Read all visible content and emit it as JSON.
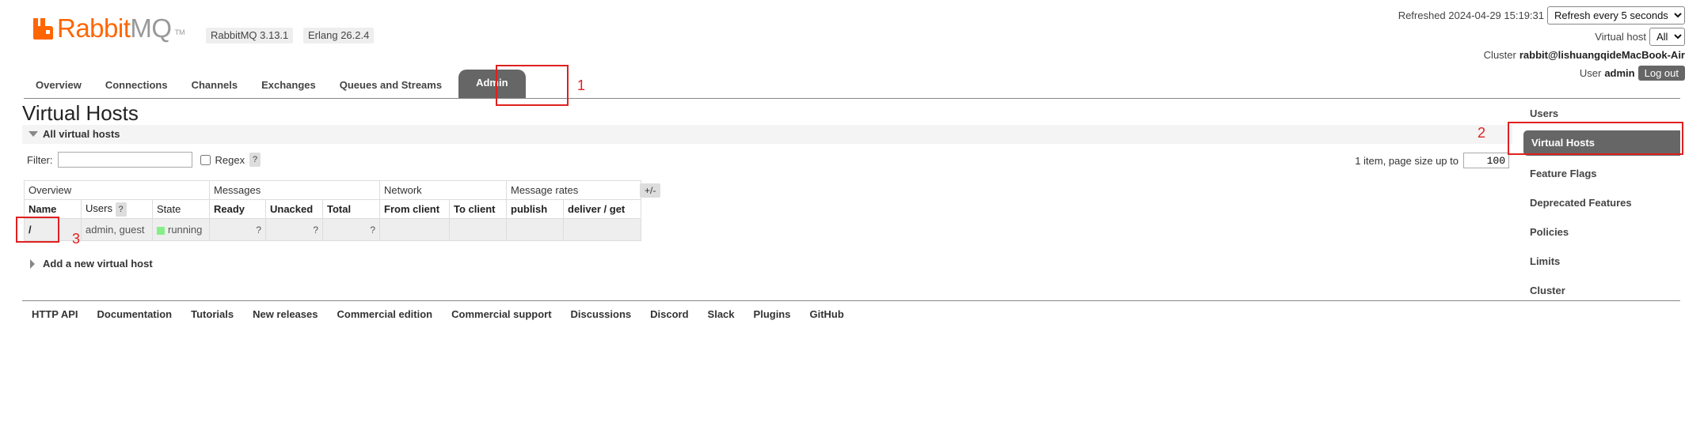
{
  "logo": {
    "part_a": "Rabbit",
    "part_b": "MQ",
    "tm": "TM"
  },
  "versions": {
    "rabbitmq": "RabbitMQ 3.13.1",
    "erlang": "Erlang 26.2.4"
  },
  "header": {
    "refreshed_label": "Refreshed 2024-04-29 15:19:31",
    "refresh_select": "Refresh every 5 seconds",
    "vhost_label": "Virtual host",
    "vhost_select": "All",
    "cluster_label": "Cluster",
    "cluster_value": "rabbit@lishuangqideMacBook-Air",
    "user_label": "User",
    "user_value": "admin",
    "logout": "Log out"
  },
  "tabs": [
    "Overview",
    "Connections",
    "Channels",
    "Exchanges",
    "Queues and Streams",
    "Admin"
  ],
  "active_tab": "Admin",
  "page_title": "Virtual Hosts",
  "section": {
    "label": "All virtual hosts"
  },
  "filter": {
    "label": "Filter:",
    "value": "",
    "regex_label": "Regex",
    "help": "?"
  },
  "pagination": {
    "label": "1 item, page size up to",
    "page_size": "100"
  },
  "table": {
    "groups": [
      "Overview",
      "Messages",
      "Network",
      "Message rates"
    ],
    "columns": [
      "Name",
      "Users",
      "State",
      "Ready",
      "Unacked",
      "Total",
      "From client",
      "To client",
      "publish",
      "deliver / get"
    ],
    "users_help": "?",
    "plusminus": "+/-",
    "rows": [
      {
        "name": "/",
        "users": "admin, guest",
        "state": "running",
        "ready": "?",
        "unacked": "?",
        "total": "?",
        "from_client": "",
        "to_client": "",
        "publish": "",
        "deliver_get": ""
      }
    ]
  },
  "add_new": "Add a new virtual host",
  "footer": [
    "HTTP API",
    "Documentation",
    "Tutorials",
    "New releases",
    "Commercial edition",
    "Commercial support",
    "Discussions",
    "Discord",
    "Slack",
    "Plugins",
    "GitHub"
  ],
  "sidebar": [
    "Users",
    "Virtual Hosts",
    "Feature Flags",
    "Deprecated Features",
    "Policies",
    "Limits",
    "Cluster"
  ],
  "active_sidebar": "Virtual Hosts",
  "annotations": [
    "1",
    "2",
    "3"
  ],
  "colors": {
    "brand_orange": "#ff6600",
    "annotation_red": "#e02020",
    "active_tab": "#666666",
    "running_green": "#88ee88"
  }
}
